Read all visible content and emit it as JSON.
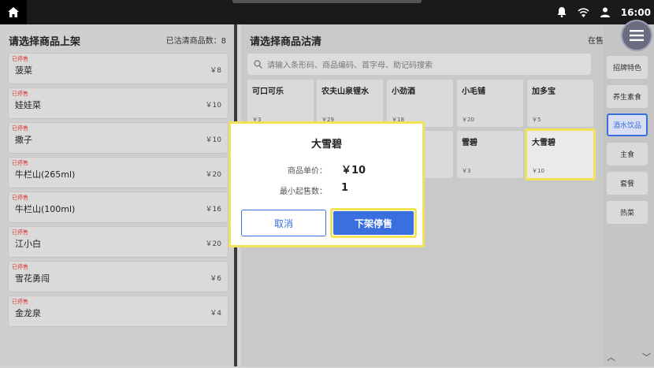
{
  "status": {
    "time": "16:00"
  },
  "left": {
    "title": "请选择商品上架",
    "count_label": "已沽清商品数：8",
    "items": [
      {
        "badge": "已停售",
        "name": "菠菜",
        "price": "￥8"
      },
      {
        "badge": "已停售",
        "name": "娃娃菜",
        "price": "￥10"
      },
      {
        "badge": "已停售",
        "name": "撒子",
        "price": "￥10"
      },
      {
        "badge": "已停售",
        "name": "牛栏山(265ml)",
        "price": "￥20"
      },
      {
        "badge": "已停售",
        "name": "牛栏山(100ml)",
        "price": "￥16"
      },
      {
        "badge": "已停售",
        "name": "江小白",
        "price": "￥20"
      },
      {
        "badge": "已停售",
        "name": "雪花勇闯",
        "price": "￥6"
      },
      {
        "badge": "已停售",
        "name": "金龙泉",
        "price": "￥4"
      }
    ]
  },
  "right": {
    "title": "请选择商品沽清",
    "count_label": "在售商品",
    "search_placeholder": "请输入条形码、商品编码、首字母、助记码搜索",
    "cards": [
      {
        "name": "可口可乐",
        "price": "￥3"
      },
      {
        "name": "农夫山泉锂水",
        "price": "￥29"
      },
      {
        "name": "小劲酒",
        "price": "￥18"
      },
      {
        "name": "小毛铺",
        "price": "￥20"
      },
      {
        "name": "加多宝",
        "price": "￥5"
      },
      {
        "name": "",
        "price": ""
      },
      {
        "name": "",
        "price": ""
      },
      {
        "name": "雪碧",
        "price": "￥3"
      },
      {
        "name": "大雪碧",
        "price": "￥10"
      }
    ]
  },
  "categories": [
    "招牌特色",
    "养生素食",
    "酒水饮品",
    "主食",
    "套餐",
    "热菜"
  ],
  "dialog": {
    "title": "大雪碧",
    "price_label": "商品单价：",
    "price_value": "￥10",
    "min_label": "最小起售数：",
    "min_value": "1",
    "cancel_label": "取消",
    "confirm_label": "下架停售"
  },
  "icons": {
    "home": "home-icon",
    "bell": "bell-icon",
    "wifi": "wifi-icon",
    "user": "user-icon",
    "menu": "hamburger-menu-icon",
    "search": "search-icon"
  },
  "colors": {
    "accent": "#3a6fe0",
    "highlight": "#f0e35a",
    "badge": "#e03030"
  }
}
